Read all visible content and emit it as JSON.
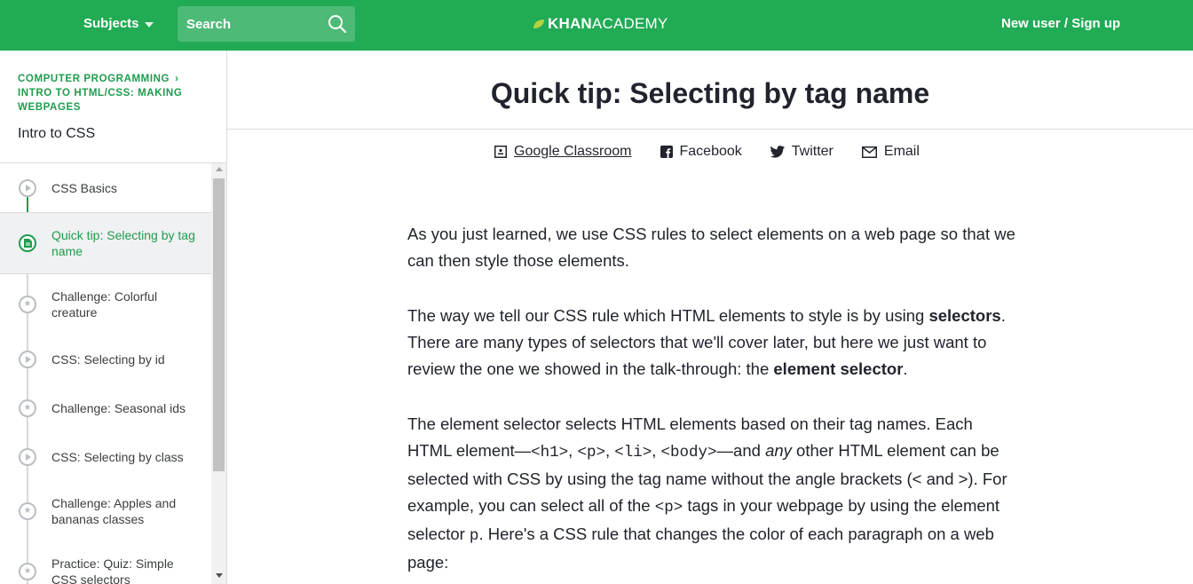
{
  "topbar": {
    "subjects_label": "Subjects",
    "search_placeholder": "Search",
    "logo_bold": "KHAN",
    "logo_light": "ACADEMY",
    "signup_label": "New user / Sign up"
  },
  "sidebar": {
    "breadcrumb_1": "COMPUTER PROGRAMMING",
    "breadcrumb_2": "INTRO TO HTML/CSS: MAKING WEBPAGES",
    "unit_title": "Intro to CSS",
    "items": [
      {
        "label": "CSS Basics",
        "type": "video"
      },
      {
        "label": "Quick tip: Selecting by tag name",
        "type": "article"
      },
      {
        "label": "Challenge: Colorful creature",
        "type": "challenge"
      },
      {
        "label": "CSS: Selecting by id",
        "type": "video"
      },
      {
        "label": "Challenge: Seasonal ids",
        "type": "challenge"
      },
      {
        "label": "CSS: Selecting by class",
        "type": "video"
      },
      {
        "label": "Challenge: Apples and bananas classes",
        "type": "challenge"
      },
      {
        "label": "Practice: Quiz: Simple CSS selectors",
        "type": "challenge"
      }
    ]
  },
  "main": {
    "title": "Quick tip: Selecting by tag name",
    "share": {
      "google_classroom": "Google Classroom",
      "facebook": "Facebook",
      "twitter": "Twitter",
      "email": "Email"
    },
    "p1": "As you just learned, we use CSS rules to select elements on a web page so that we can then style those elements.",
    "p2_a": "The way we tell our CSS rule which HTML elements to style is by using ",
    "p2_b": "selectors",
    "p2_c": ". There are many types of selectors that we'll cover later, but here we just want to review the one we showed in the talk-through: the ",
    "p2_d": "element selector",
    "p2_e": ".",
    "p3_a": "The element selector selects HTML elements based on their tag names. Each HTML element—",
    "p3_code1": "<h1>",
    "p3_sep1": ", ",
    "p3_code2": "<p>",
    "p3_sep2": ", ",
    "p3_code3": "<li>",
    "p3_sep3": ", ",
    "p3_code4": "<body>",
    "p3_b": "—and ",
    "p3_any": "any",
    "p3_c": " other HTML element can be selected with CSS by using the tag name without the angle brackets (< and >). For example, you can select all of the ",
    "p3_code5": "<p>",
    "p3_d": " tags in your webpage by using the element selector ",
    "p3_code6": "p",
    "p3_e": ". Here's a CSS rule that changes the color of each paragraph on a web page:"
  },
  "colors": {
    "brand_green": "#21ab55",
    "link_green": "#1f9c4e"
  }
}
